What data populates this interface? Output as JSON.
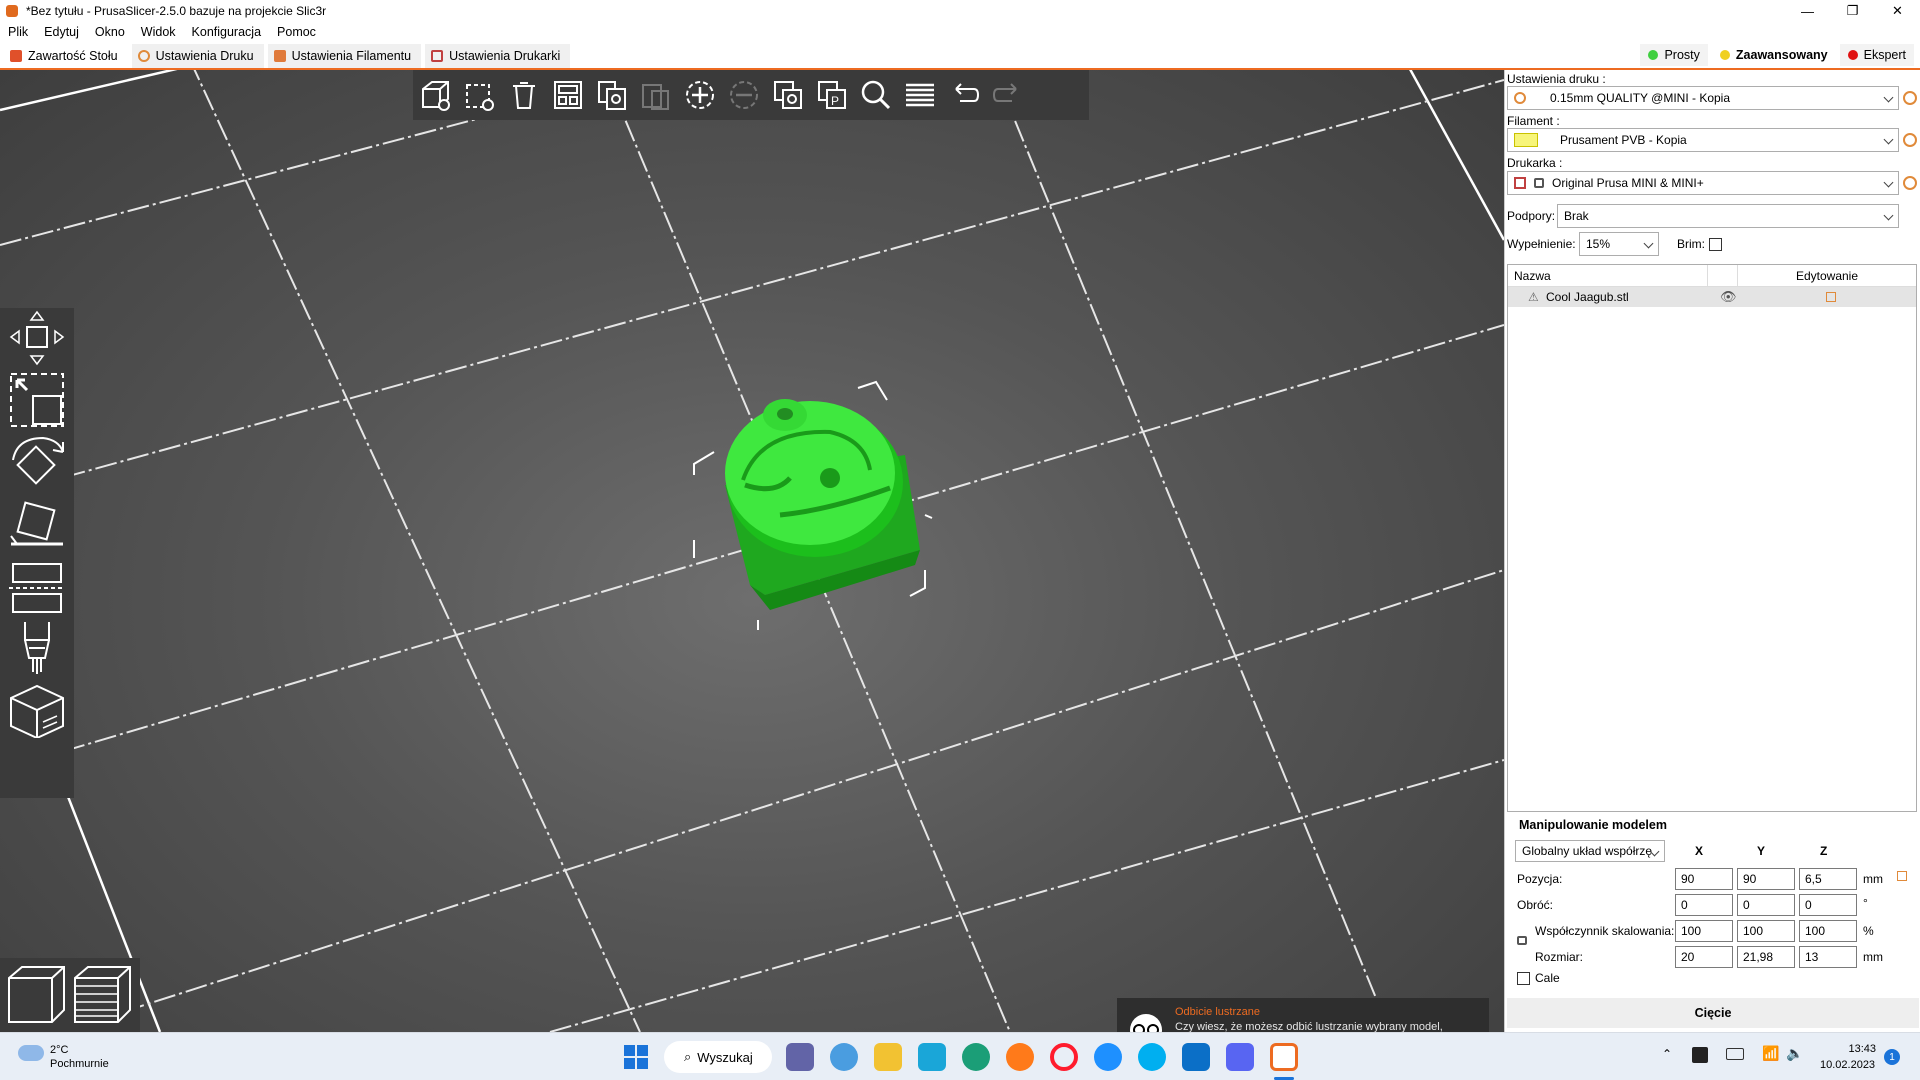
{
  "window": {
    "title": "*Bez tytułu - PrusaSlicer-2.5.0 bazuje na projekcie Slic3r"
  },
  "menu": [
    "Plik",
    "Edytuj",
    "Okno",
    "Widok",
    "Konfiguracja",
    "Pomoc"
  ],
  "tabs": [
    {
      "label": "Zawartość Stołu",
      "color": "#e0502a"
    },
    {
      "label": "Ustawienia Druku",
      "color": "#e08a3a"
    },
    {
      "label": "Ustawienia Filamentu",
      "color": "#e07a3a"
    },
    {
      "label": "Ustawienia Drukarki",
      "color": "#c04040"
    }
  ],
  "modes": [
    {
      "label": "Prosty",
      "color": "#3fcf3f"
    },
    {
      "label": "Zaawansowany",
      "color": "#f0d020"
    },
    {
      "label": "Ekspert",
      "color": "#e01010"
    }
  ],
  "sidebar": {
    "print_label": "Ustawienia druku :",
    "print_value": "0.15mm QUALITY @MINI - Kopia",
    "filament_label": "Filament :",
    "filament_value": "Prusament PVB - Kopia",
    "filament_color": "#f7f57a",
    "printer_label": "Drukarka :",
    "printer_value": "Original Prusa MINI & MINI+",
    "supports_label": "Podpory:",
    "supports_value": "Brak",
    "infill_label": "Wypełnienie:",
    "infill_value": "15%",
    "brim_label": "Brim:",
    "col_name": "Nazwa",
    "col_edit": "Edytowanie",
    "object_name": "Cool Jaagub.stl"
  },
  "manip": {
    "title": "Manipulowanie modelem",
    "coord": "Globalny układ współrzę",
    "x": "X",
    "y": "Y",
    "z": "Z",
    "position_label": "Pozycja:",
    "position": [
      "90",
      "90",
      "6,5"
    ],
    "rotate_label": "Obróć:",
    "rotate": [
      "0",
      "0",
      "0"
    ],
    "scale_label": "Współczynnik skalowania:",
    "scale": [
      "100",
      "100",
      "100"
    ],
    "size_label": "Rozmiar:",
    "size": [
      "20",
      "21,98",
      "13"
    ],
    "unit_mm": "mm",
    "unit_deg": "°",
    "unit_pct": "%",
    "inches_label": "Cale"
  },
  "slice_label": "Cięcie",
  "notification": {
    "title": "Odbicie lustrzane",
    "text": "Czy wiesz, że możesz odbić lustrzanie wybrany model, aby stworzyć jego odwróconą wersję? Kliknij prawym przyciskiem myszy na model, wybierz \"Lustrzane\", następnie oś, w której ma zostać odbity."
  },
  "taskbar": {
    "weather_temp": "2°C",
    "weather_desc": "Pochmurnie",
    "search_label": "Wyszukaj",
    "time": "13:43",
    "date": "10.02.2023",
    "badge": "1"
  }
}
